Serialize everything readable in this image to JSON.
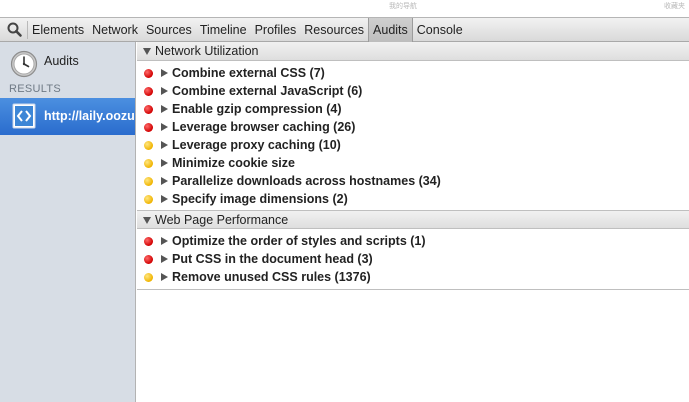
{
  "page_strip": {
    "faint_text_left": "我的导航",
    "faint_text_right": "收藏夹"
  },
  "toolbar": {
    "tabs": [
      {
        "label": "Elements"
      },
      {
        "label": "Network"
      },
      {
        "label": "Sources"
      },
      {
        "label": "Timeline"
      },
      {
        "label": "Profiles"
      },
      {
        "label": "Resources"
      },
      {
        "label": "Audits",
        "active": true
      },
      {
        "label": "Console"
      }
    ]
  },
  "sidebar": {
    "audits_label": "Audits",
    "results_label": "RESULTS",
    "result_item": "http://laily.oozu."
  },
  "sections": [
    {
      "title": "Network Utilization",
      "rules": [
        {
          "severity": "red",
          "label": "Combine external CSS (7)"
        },
        {
          "severity": "red",
          "label": "Combine external JavaScript (6)"
        },
        {
          "severity": "red",
          "label": "Enable gzip compression (4)"
        },
        {
          "severity": "red",
          "label": "Leverage browser caching (26)"
        },
        {
          "severity": "yellow",
          "label": "Leverage proxy caching (10)"
        },
        {
          "severity": "yellow",
          "label": "Minimize cookie size"
        },
        {
          "severity": "yellow",
          "label": "Parallelize downloads across hostnames (34)"
        },
        {
          "severity": "yellow",
          "label": "Specify image dimensions (2)"
        }
      ]
    },
    {
      "title": "Web Page Performance",
      "rules": [
        {
          "severity": "red",
          "label": "Optimize the order of styles and scripts (1)"
        },
        {
          "severity": "red",
          "label": "Put CSS in the document head (3)"
        },
        {
          "severity": "yellow",
          "label": "Remove unused CSS rules (1376)"
        }
      ]
    }
  ],
  "colors": {
    "accent": "#3a7bd8",
    "error": "#d10000",
    "warning": "#f0b400",
    "sidebar_bg": "#d7dde5"
  }
}
